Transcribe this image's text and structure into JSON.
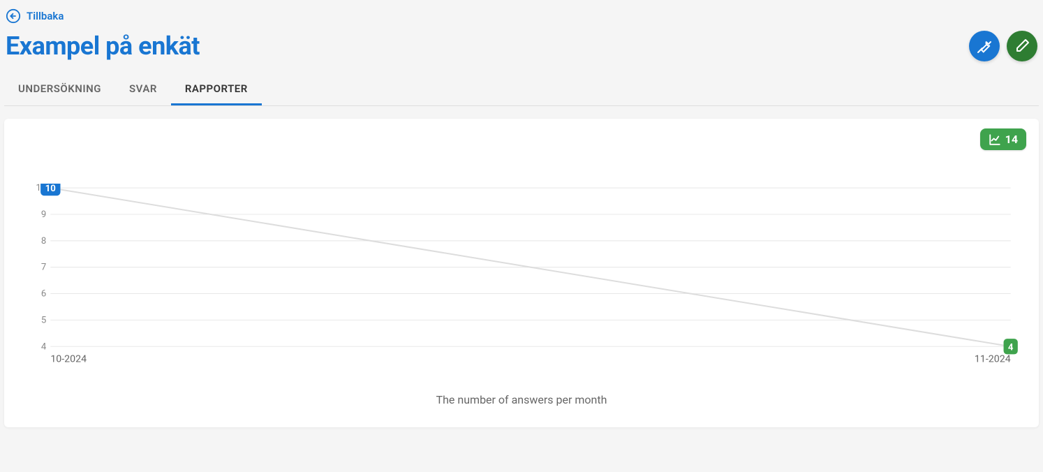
{
  "back_label": "Tillbaka",
  "page_title": "Exampel på enkät",
  "tabs": [
    {
      "label": "UNDERSÖKNING",
      "active": false
    },
    {
      "label": "SVAR",
      "active": false
    },
    {
      "label": "RAPPORTER",
      "active": true
    }
  ],
  "badge_count": "14",
  "chart_data": {
    "type": "line",
    "title": "The number of answers per month",
    "xlabel": "",
    "ylabel": "",
    "categories": [
      "10-2024",
      "11-2024"
    ],
    "values": [
      10,
      4
    ],
    "ylim": [
      4,
      10
    ],
    "yticks": [
      4,
      5,
      6,
      7,
      8,
      9,
      10
    ],
    "point_colors": [
      "#1976d2",
      "#3fa34d"
    ]
  },
  "colors": {
    "primary": "#1976d2",
    "success": "#3fa34d",
    "success_dark": "#2e7d32"
  }
}
